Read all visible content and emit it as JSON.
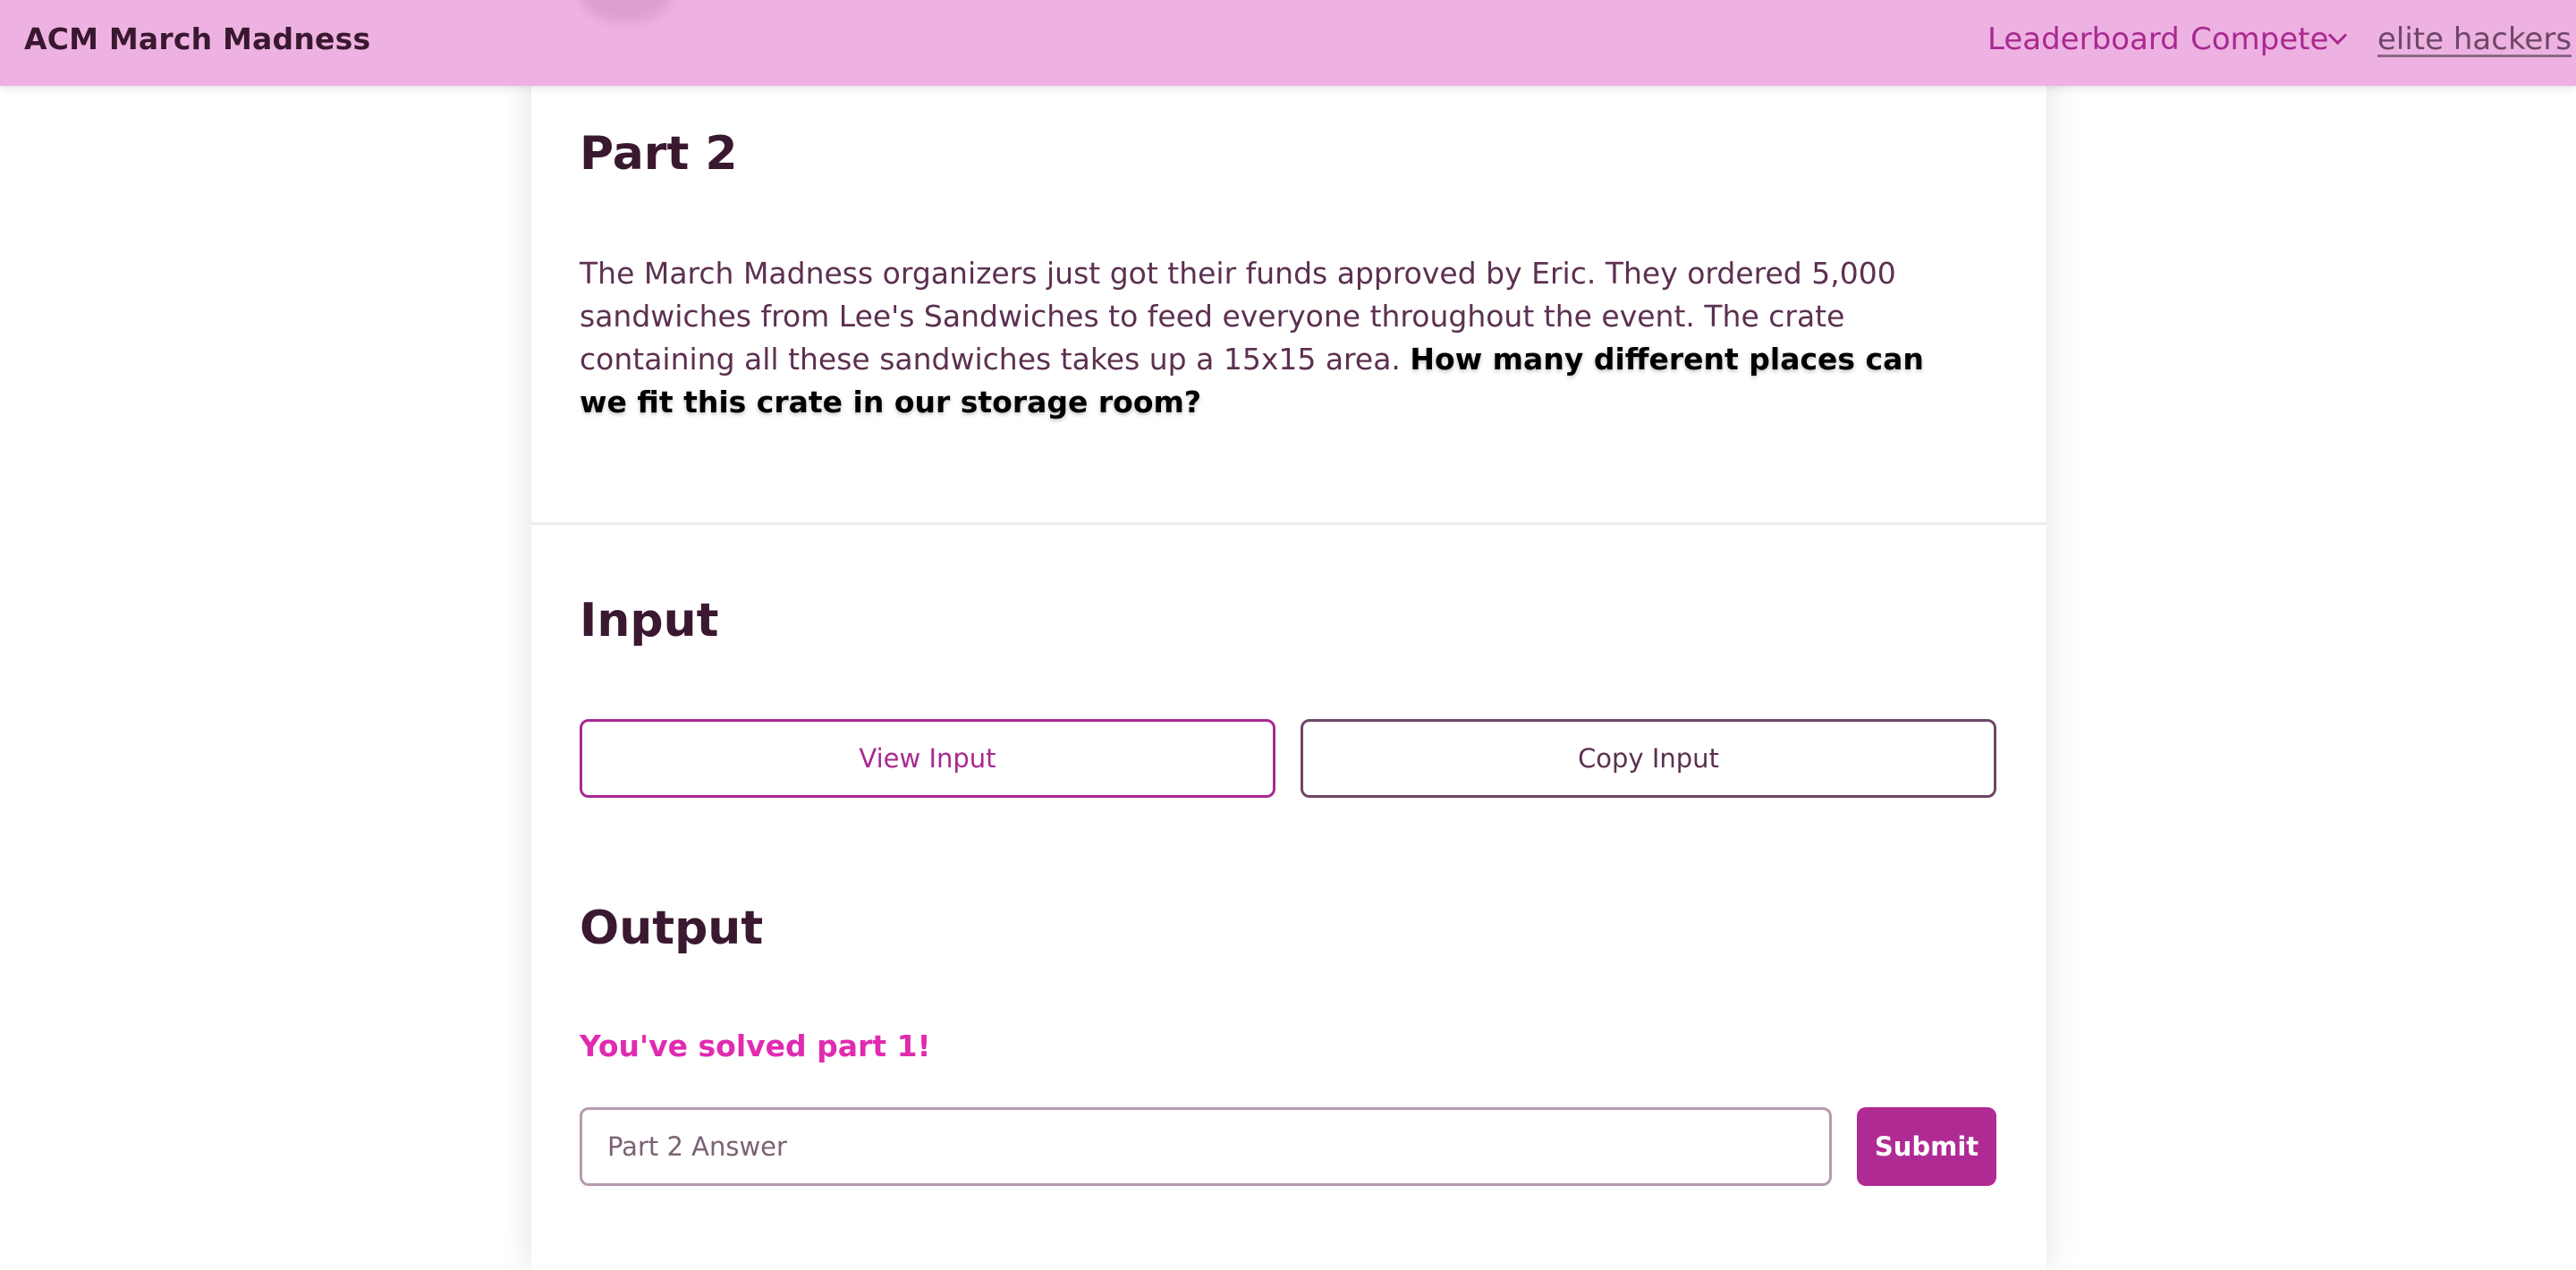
{
  "colors": {
    "navbar_bg": "#eeb2e2",
    "accent": "#a8298f",
    "heading": "#3a1830",
    "body_text": "#5c3050",
    "success": "#e02bb0",
    "submit_bg": "#b02a94"
  },
  "navbar": {
    "brand": "ACM March Madness",
    "leaderboard": "Leaderboard",
    "compete": "Compete",
    "compete_icon": "chevron-down-icon",
    "team_name": "elite hackers"
  },
  "problem": {
    "part_heading": "Part 2",
    "description_plain": "The March Madness organizers just got their funds approved by Eric. They ordered 5,000 sandwiches from Lee's Sandwiches to feed everyone throughout the event. The crate containing all these sandwiches takes up a 15x15 area. ",
    "description_bold": "How many different places can we fit this crate in our storage room?"
  },
  "input_section": {
    "heading": "Input",
    "view_button": "View Input",
    "copy_button": "Copy Input"
  },
  "output_section": {
    "heading": "Output",
    "status": "You've solved part 1!",
    "answer_placeholder": "Part 2 Answer",
    "answer_value": "",
    "submit_button": "Submit"
  }
}
